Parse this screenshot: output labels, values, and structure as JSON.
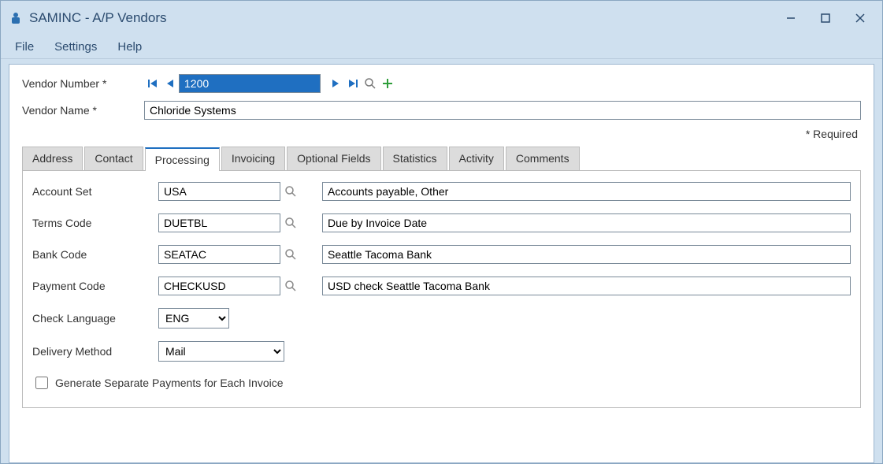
{
  "window": {
    "title": "SAMINC - A/P Vendors"
  },
  "menu": {
    "file": "File",
    "settings": "Settings",
    "help": "Help"
  },
  "header": {
    "vendor_number_label": "Vendor Number *",
    "vendor_number_value": "1200",
    "vendor_name_label": "Vendor Name *",
    "vendor_name_value": "Chloride Systems",
    "required_note": "* Required"
  },
  "tabs": {
    "address": "Address",
    "contact": "Contact",
    "processing": "Processing",
    "invoicing": "Invoicing",
    "optional_fields": "Optional Fields",
    "statistics": "Statistics",
    "activity": "Activity",
    "comments": "Comments"
  },
  "processing": {
    "account_set_label": "Account Set",
    "account_set_code": "USA",
    "account_set_desc": "Accounts payable, Other",
    "terms_code_label": "Terms Code",
    "terms_code_code": "DUETBL",
    "terms_code_desc": "Due by Invoice Date",
    "bank_code_label": "Bank Code",
    "bank_code_code": "SEATAC",
    "bank_code_desc": "Seattle Tacoma Bank",
    "payment_code_label": "Payment Code",
    "payment_code_code": "CHECKUSD",
    "payment_code_desc": "USD check Seattle Tacoma Bank",
    "check_language_label": "Check Language",
    "check_language_value": "ENG",
    "delivery_method_label": "Delivery Method",
    "delivery_method_value": "Mail",
    "separate_payments_label": "Generate Separate Payments for Each Invoice"
  }
}
